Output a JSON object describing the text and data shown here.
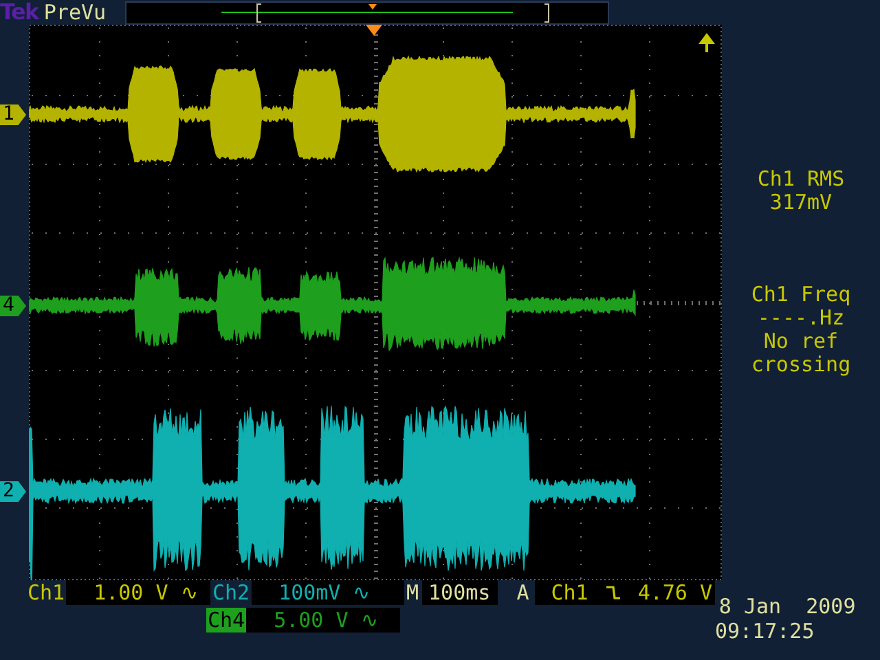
{
  "brand": "Tek",
  "mode": "PreVu",
  "traces": [
    {
      "marker": "1",
      "color": "#b4b400"
    },
    {
      "marker": "4",
      "color": "#1ea01e"
    },
    {
      "marker": "2",
      "color": "#10b0b0"
    }
  ],
  "measurements": [
    {
      "lines": [
        "Ch1 RMS",
        "317mV"
      ]
    },
    {
      "lines": [
        "Ch1 Freq",
        "----.Hz",
        "No ref",
        "crossing"
      ]
    }
  ],
  "channel_readouts": [
    {
      "label": "Ch1",
      "value": "1.00 V ∿",
      "selected": false
    },
    {
      "label": "Ch2",
      "value": "100mV ∿",
      "selected": false
    },
    {
      "label": "Ch4",
      "value": "5.00 V ∿",
      "selected": true
    }
  ],
  "timebase": {
    "label": "M",
    "value": "100ms"
  },
  "trigger": {
    "label": "A",
    "source": "Ch1",
    "value": "4.76 V"
  },
  "date": "8 Jan  2009",
  "time": "09:17:25"
}
